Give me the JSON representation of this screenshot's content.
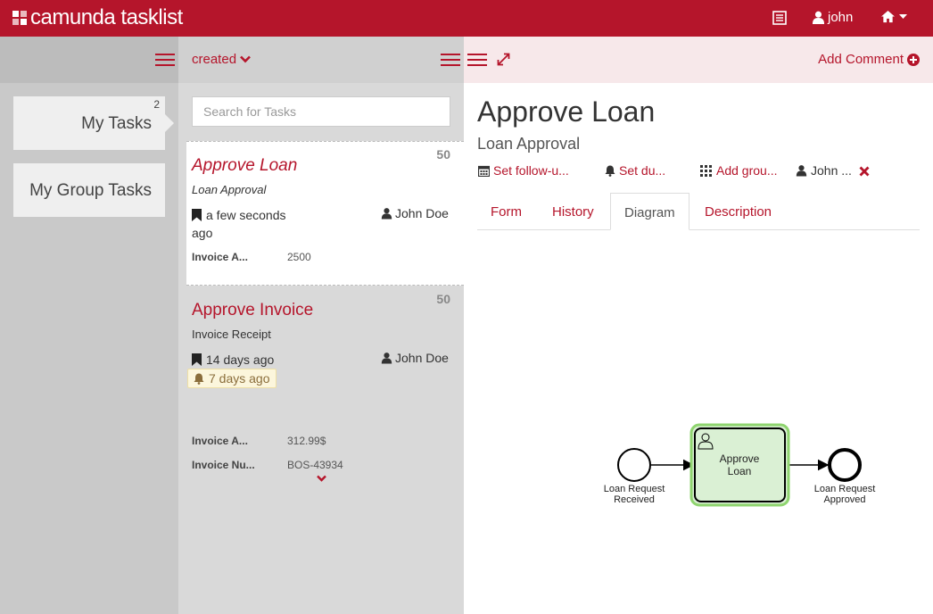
{
  "header": {
    "brand": "camunda tasklist",
    "user": "john"
  },
  "filters": [
    {
      "label": "My Tasks",
      "count": "2"
    },
    {
      "label": "My Group Tasks",
      "count": ""
    }
  ],
  "tasklist": {
    "sort_label": "created",
    "search_placeholder": "Search for Tasks",
    "tasks": [
      {
        "priority": "50",
        "name": "Approve Loan",
        "process": "Loan Approval",
        "created": "a few seconds ago",
        "assignee": "John Doe",
        "variables": [
          {
            "key": "Invoice A...",
            "value": "2500"
          }
        ]
      },
      {
        "priority": "50",
        "name": "Approve Invoice",
        "process": "Invoice Receipt",
        "created": "14 days ago",
        "due": "7 days ago",
        "assignee": "John Doe",
        "variables": [
          {
            "key": "Invoice A...",
            "value": "312.99$"
          },
          {
            "key": "Invoice Nu...",
            "value": "BOS-43934"
          }
        ]
      }
    ]
  },
  "detail": {
    "add_comment": "Add Comment",
    "task_name": "Approve Loan",
    "process_name": "Loan Approval",
    "actions": {
      "follow_up": "Set follow-u...",
      "due": "Set du...",
      "groups": "Add grou...",
      "assignee": "John ..."
    },
    "tabs": [
      "Form",
      "History",
      "Diagram",
      "Description"
    ],
    "active_tab": "Diagram",
    "diagram": {
      "start_event": "Loan Request Received",
      "start_event_l1": "Loan Request",
      "start_event_l2": "Received",
      "task_l1": "Approve",
      "task_l2": "Loan",
      "end_event_l1": "Loan Request",
      "end_event_l2": "Approved"
    }
  },
  "colors": {
    "brand": "#b5152b",
    "filter_bg": "#c9c9c9",
    "list_bg": "#d9d9d9",
    "active_task_fill": "#daf0d4",
    "active_task_highlight": "#8fd46f"
  }
}
